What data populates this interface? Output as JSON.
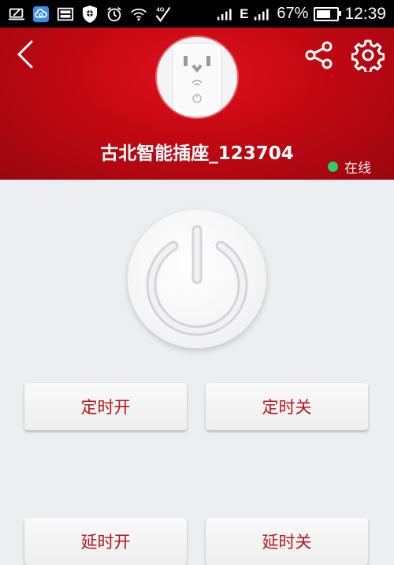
{
  "status_bar": {
    "network_label": "E",
    "network_type": "4G",
    "battery_percent": "67%",
    "battery_level": 0.67,
    "time": "12:39",
    "icons": [
      "laptop-icon",
      "cloud-app-icon",
      "image-icon",
      "shield-icon",
      "alarm-icon",
      "wifi-icon",
      "check-icon",
      "signal-icon",
      "signal-icon",
      "battery-icon"
    ]
  },
  "header": {
    "device_name": "古北智能插座_123704",
    "status": "在线",
    "status_color": "#2ecc71",
    "background_color": "#c20812"
  },
  "actions": {
    "timed_on": "定时开",
    "timed_off": "定时关",
    "delay_on": "延时开",
    "delay_off": "延时关"
  },
  "colors": {
    "accent": "#b8141c",
    "page_background": "#eceef2"
  }
}
